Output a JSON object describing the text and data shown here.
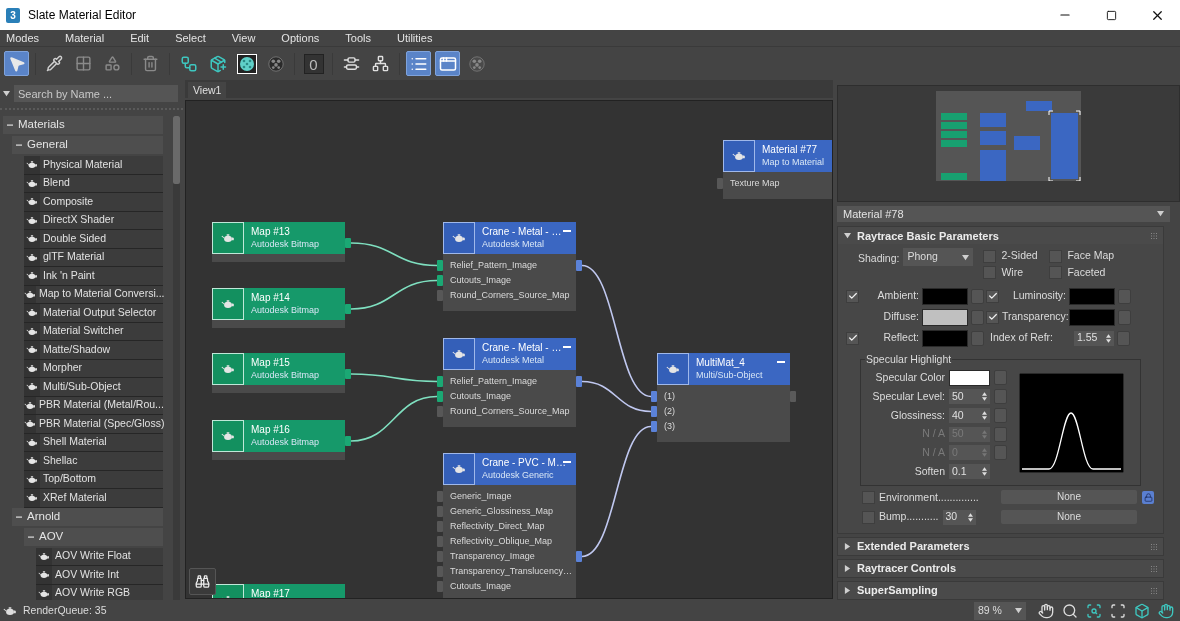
{
  "window": {
    "title": "Slate Material Editor",
    "icon_label": "3"
  },
  "menu": [
    "Modes",
    "Material",
    "Edit",
    "Select",
    "View",
    "Options",
    "Tools",
    "Utilities"
  ],
  "toolbar": [
    {
      "selected": true
    },
    {
      "selected": false
    },
    {
      "selected": false
    },
    {
      "selected": false
    },
    {
      "selected": false
    },
    {
      "selected": false
    },
    {
      "selected": false
    },
    {
      "selected": false
    },
    {
      "selected": false
    },
    {
      "selected": false,
      "text": "0"
    },
    {
      "selected": false
    },
    {
      "selected": false
    },
    {
      "selected": true
    },
    {
      "selected": true
    },
    {
      "selected": false
    }
  ],
  "material_browser": {
    "search": {
      "placeholder": "Search by Name ..."
    },
    "tree": [
      {
        "label": "Materials",
        "expanded": true,
        "children": [
          {
            "label": "General",
            "expanded": true,
            "children": [
              {
                "label": "Physical Material"
              },
              {
                "label": "Blend"
              },
              {
                "label": "Composite"
              },
              {
                "label": "DirectX Shader"
              },
              {
                "label": "Double Sided"
              },
              {
                "label": "glTF Material"
              },
              {
                "label": "Ink 'n Paint"
              },
              {
                "label": "Map to Material Conversi..."
              },
              {
                "label": "Material Output Selector"
              },
              {
                "label": "Material Switcher"
              },
              {
                "label": "Matte/Shadow"
              },
              {
                "label": "Morpher"
              },
              {
                "label": "Multi/Sub-Object"
              },
              {
                "label": "PBR Material (Metal/Rou..."
              },
              {
                "label": "PBR Material (Spec/Gloss)"
              },
              {
                "label": "Shell Material"
              },
              {
                "label": "Shellac"
              },
              {
                "label": "Top/Bottom"
              },
              {
                "label": "XRef Material"
              }
            ]
          },
          {
            "label": "Arnold",
            "expanded": true,
            "children": [
              {
                "label": "AOV",
                "expanded": true,
                "children": [
                  {
                    "label": "AOV Write Float"
                  },
                  {
                    "label": "AOV Write Int"
                  },
                  {
                    "label": "AOV Write RGB"
                  }
                ]
              }
            ]
          }
        ]
      }
    ]
  },
  "view_tabs": [
    {
      "label": "View1",
      "selected": true
    }
  ],
  "nodes": [
    {
      "kind": "material",
      "title": "Material #77",
      "subtitle": "Map to Material",
      "slots": [
        {
          "label": "Texture Map",
          "connected": false
        }
      ]
    },
    {
      "kind": "map",
      "title": "Map #13",
      "subtitle": "Autodesk Bitmap",
      "output_connected": true
    },
    {
      "kind": "map",
      "title": "Map #14",
      "subtitle": "Autodesk Bitmap",
      "output_connected": true
    },
    {
      "kind": "map",
      "title": "Map #15",
      "subtitle": "Autodesk Bitmap",
      "output_connected": true
    },
    {
      "kind": "map",
      "title": "Map #16",
      "subtitle": "Autodesk Bitmap",
      "output_connected": true
    },
    {
      "kind": "map",
      "title": "Map #17"
    },
    {
      "kind": "material",
      "title": "Crane - Metal - …",
      "subtitle": "Autodesk Metal",
      "output_connected": true,
      "slots": [
        {
          "label": "Relief_Pattern_Image",
          "connected": true
        },
        {
          "label": "Cutouts_Image",
          "connected": true
        },
        {
          "label": "Round_Corners_Source_Map",
          "connected": false
        }
      ]
    },
    {
      "kind": "material",
      "title": "Crane - Metal - …",
      "subtitle": "Autodesk Metal",
      "output_connected": true,
      "slots": [
        {
          "label": "Relief_Pattern_Image",
          "connected": true
        },
        {
          "label": "Cutouts_Image",
          "connected": true
        },
        {
          "label": "Round_Corners_Source_Map",
          "connected": false
        }
      ]
    },
    {
      "kind": "material",
      "title": "Crane - PVC - M…",
      "subtitle": "Autodesk Generic",
      "output_connected": true,
      "slots": [
        {
          "label": "Generic_Image",
          "connected": false
        },
        {
          "label": "Generic_Glossiness_Map",
          "connected": false
        },
        {
          "label": "Reflectivity_Direct_Map",
          "connected": false
        },
        {
          "label": "Reflectivity_Oblique_Map",
          "connected": false
        },
        {
          "label": "Transparency_Image",
          "connected": false
        },
        {
          "label": "Transparency_Translucency…",
          "connected": false
        },
        {
          "label": "Cutouts_Image",
          "connected": false
        }
      ]
    },
    {
      "kind": "material",
      "title": "MultiMat_4",
      "subtitle": "Multi/Sub-Object",
      "output_connected": false,
      "slots": [
        {
          "label": "(1)",
          "connected": true
        },
        {
          "label": "(2)",
          "connected": true
        },
        {
          "label": "(3)",
          "connected": true
        }
      ]
    }
  ],
  "material_panel": {
    "material_name": "Material #78",
    "rollouts": [
      {
        "title": "Raytrace Basic Parameters",
        "expanded": true
      },
      {
        "title": "Extended Parameters",
        "expanded": false
      },
      {
        "title": "Raytracer Controls",
        "expanded": false
      },
      {
        "title": "SuperSampling",
        "expanded": false
      }
    ],
    "basic": {
      "shading_label": "Shading:",
      "shading": "Phong",
      "options": [
        {
          "label": "2-Sided",
          "checked": false
        },
        {
          "label": "Face Map",
          "checked": false
        },
        {
          "label": "Wire",
          "checked": false
        },
        {
          "label": "Faceted",
          "checked": false
        }
      ],
      "colors": [
        {
          "label": "Ambient:",
          "checked": true,
          "color": "#000000"
        },
        {
          "label": "Luminosity:",
          "checked": true,
          "color": "#000000"
        },
        {
          "label": "Diffuse:",
          "color": "#c0c0c0"
        },
        {
          "label": "Transparency:",
          "checked": true,
          "color": "#000000"
        },
        {
          "label": "Reflect:",
          "checked": true,
          "color": "#000000"
        }
      ],
      "index_of_refraction": {
        "label": "Index of Refr:",
        "value": "1.55"
      },
      "specular": {
        "title": "Specular Highlight",
        "color": {
          "label": "Specular Color",
          "color": "#ffffff"
        },
        "fields": [
          {
            "label": "Specular Level:",
            "value": "50",
            "disabled": false,
            "map_button": true
          },
          {
            "label": "Glossiness:",
            "value": "40",
            "disabled": false,
            "map_button": true
          },
          {
            "label": "N / A",
            "value": "50",
            "disabled": true,
            "map_button": true
          },
          {
            "label": "N / A",
            "value": "0",
            "disabled": true,
            "map_button": true
          },
          {
            "label": "Soften",
            "value": "0.1",
            "disabled": false,
            "map_button": false
          }
        ]
      },
      "maps": [
        {
          "label": "Environment..............",
          "checked": false,
          "button": "None",
          "locked": true
        },
        {
          "label": "Bump...........",
          "checked": false,
          "amount": "30",
          "button": "None",
          "locked": false
        }
      ]
    }
  },
  "status_bar": {
    "render_queue": "RenderQueue: 35",
    "zoom": "89 %"
  }
}
